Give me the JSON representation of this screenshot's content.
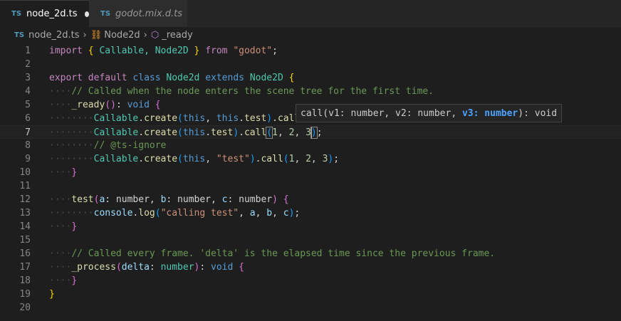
{
  "tabs": [
    {
      "badge": "TS",
      "label": "node_2d.ts",
      "active": true,
      "dirty": true
    },
    {
      "badge": "TS",
      "label": "godot.mix.d.ts",
      "active": false,
      "dirty": false
    }
  ],
  "breadcrumb": {
    "file_badge": "TS",
    "file": "node_2d.ts",
    "class": "Node2d",
    "method": "_ready"
  },
  "line_numbers": [
    "1",
    "2",
    "3",
    "4",
    "5",
    "6",
    "7",
    "8",
    "9",
    "10",
    "11",
    "12",
    "13",
    "14",
    "15",
    "16",
    "17",
    "18",
    "19",
    "20"
  ],
  "code": {
    "line1": {
      "kw": "import",
      "b1": "{",
      "a": "Callable,",
      "b": "Node2D",
      "b2": "}",
      "from": "from",
      "str": "\"godot\"",
      "end": ";"
    },
    "line3": {
      "export": "export",
      "default": "default",
      "class": "class",
      "name": "Node2d",
      "extends": "extends",
      "base": "Node2D",
      "brace": "{"
    },
    "line4": {
      "comment": "// Called when the node enters the scene tree for the first time."
    },
    "line5": {
      "fn": "_ready",
      "paren": "()",
      "colon": ":",
      "type": "void",
      "brace": "{"
    },
    "line6": {
      "cls": "Callable",
      "dot": ".",
      "fn": "create",
      "p1": "(",
      "this1": "this",
      "comma": ", ",
      "this2": "this",
      "dot2": ".",
      "prop": "test",
      "p2": ")",
      "dot3": ".",
      "call": "call"
    },
    "line7": {
      "cls": "Callable",
      "dot": ".",
      "fn": "create",
      "p1": "(",
      "this": "this",
      "dot2": ".",
      "prop": "test",
      "p2": ")",
      "dot3": ".",
      "call": "call",
      "p3": "(",
      "n1": "1",
      "c1": ", ",
      "n2": "2",
      "c2": ", ",
      "n3": "3",
      "p4": ")",
      "end": ";"
    },
    "line8": {
      "comment": "// @ts-ignore"
    },
    "line9": {
      "cls": "Callable",
      "dot": ".",
      "fn": "create",
      "p1": "(",
      "this": "this",
      "comma": ", ",
      "str": "\"test\"",
      "p2": ")",
      "dot3": ".",
      "call": "call",
      "p3": "(",
      "n1": "1",
      "c1": ", ",
      "n2": "2",
      "c2": ", ",
      "n3": "3",
      "p4": ")",
      "end": ";"
    },
    "line10": {
      "brace": "}"
    },
    "line12": {
      "fn": "test",
      "p1": "(",
      "a": "a",
      "ta": ": number, ",
      "b": "b",
      "tb": ": number, ",
      "c": "c",
      "tc": ": number",
      "p2": ")",
      "brace": " {"
    },
    "line13": {
      "obj": "console",
      "dot": ".",
      "fn": "log",
      "p1": "(",
      "str": "\"calling test\"",
      "c1": ", ",
      "a": "a",
      "c2": ", ",
      "b": "b",
      "c3": ", ",
      "c": "c",
      "p2": ")",
      "end": ";"
    },
    "line14": {
      "brace": "}"
    },
    "line16": {
      "comment": "// Called every frame. 'delta' is the elapsed time since the previous frame."
    },
    "line17": {
      "fn": "_process",
      "p1": "(",
      "param": "delta",
      "colon": ": ",
      "type": "number",
      "p2": ")",
      "colon2": ": ",
      "ret": "void",
      "brace": " {"
    },
    "line18": {
      "brace": "}"
    },
    "line19": {
      "brace": "}"
    }
  },
  "signature_hint": {
    "prefix": "call(v1: number, v2: number, ",
    "active_param": "v3: number",
    "suffix": "): void"
  }
}
